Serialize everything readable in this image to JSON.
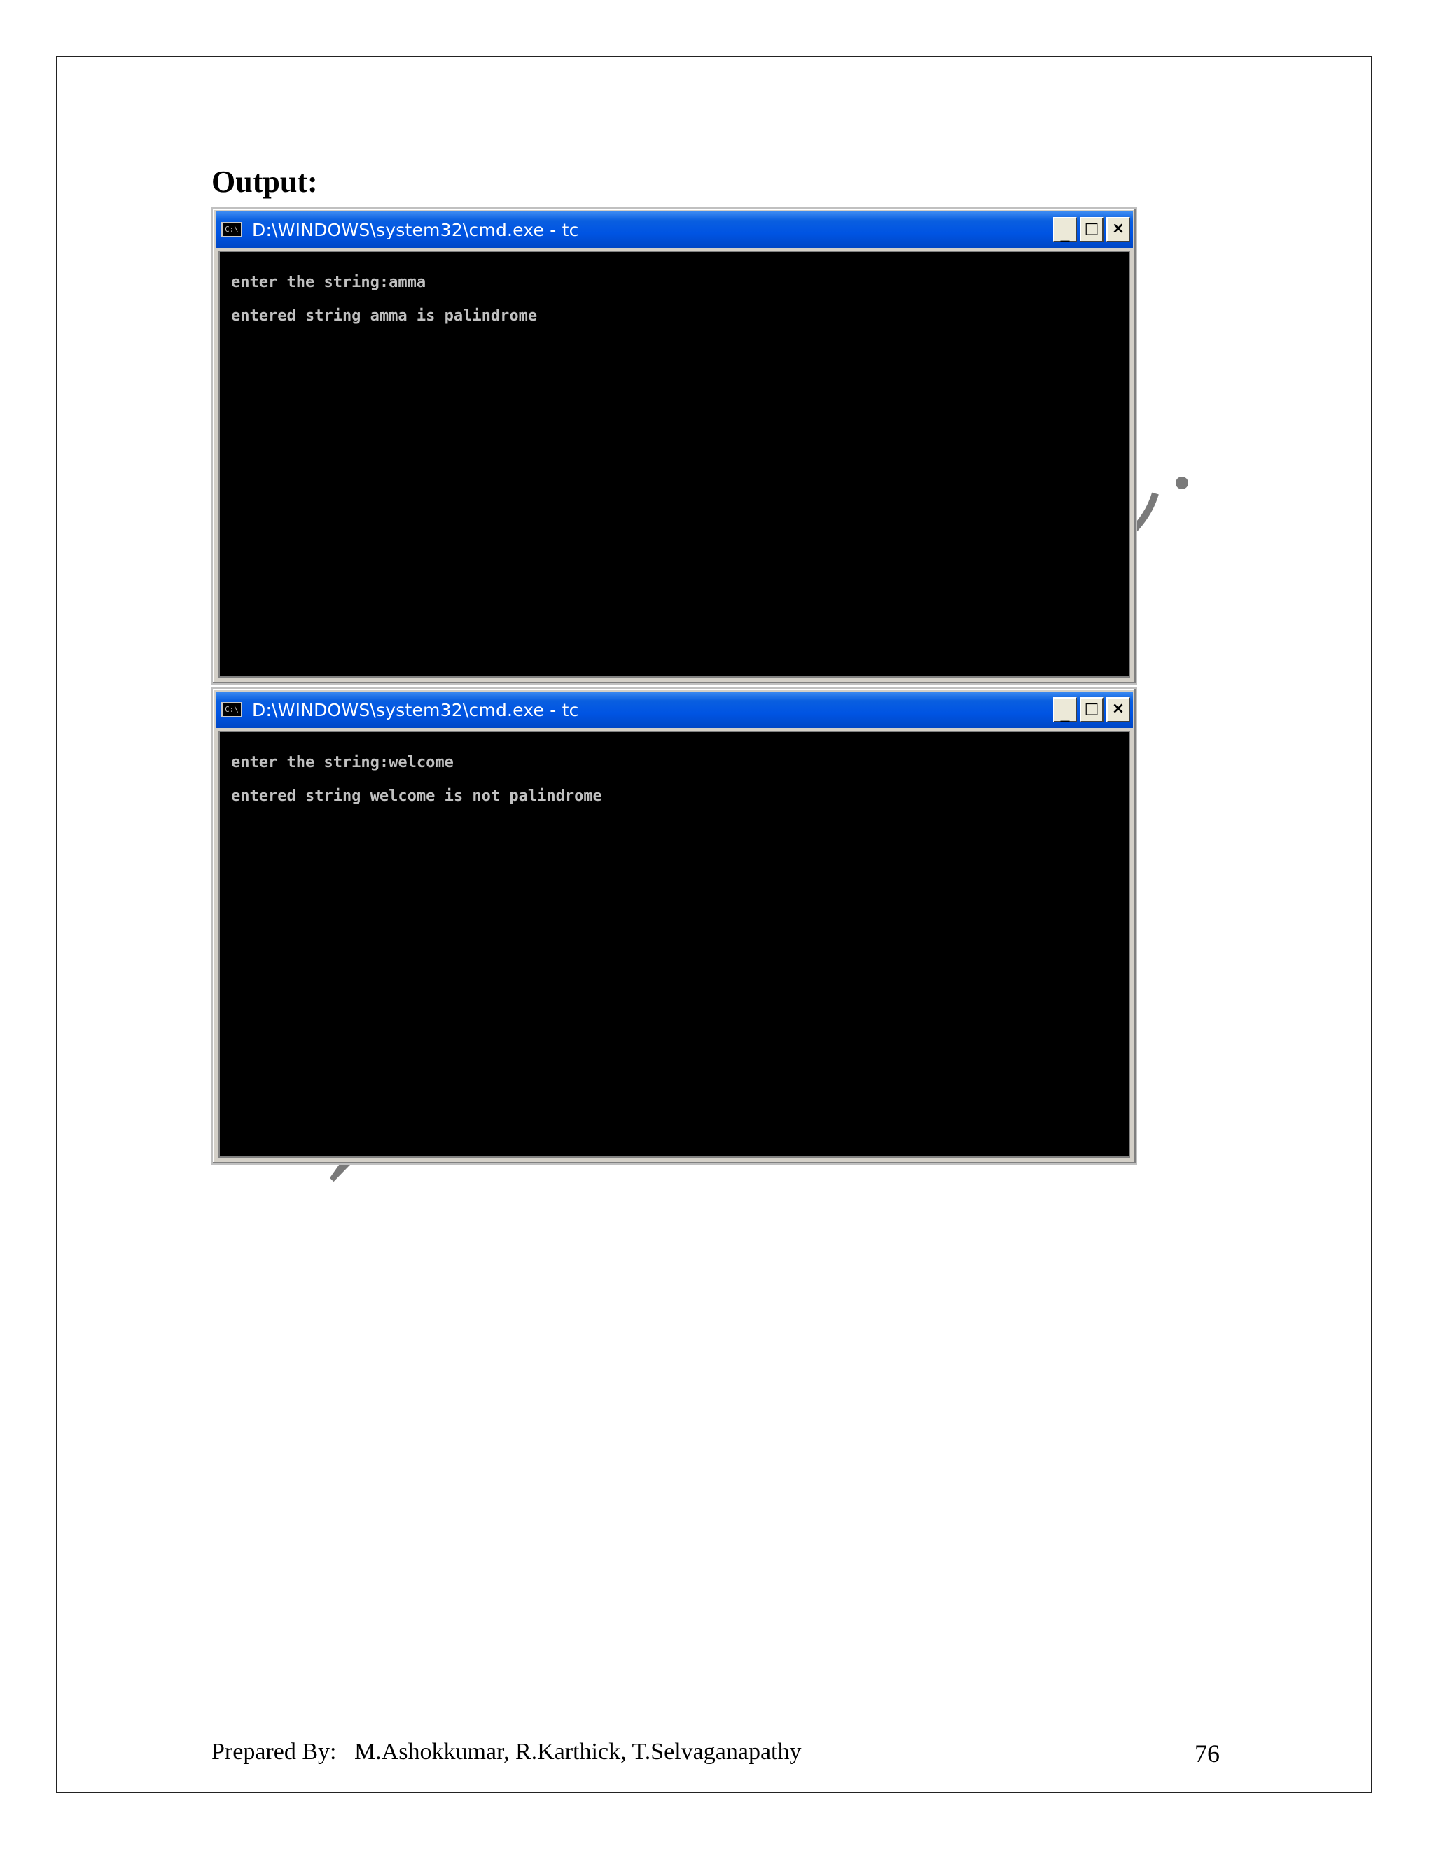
{
  "document": {
    "heading": "Output:",
    "watermark_text": "Depar"
  },
  "windows": [
    {
      "title": "D:\\WINDOWS\\system32\\cmd.exe - tc",
      "icon_label": "C:\\",
      "icon": "console-window-icon",
      "buttons": {
        "minimize": "_",
        "maximize": "□",
        "close": "×"
      },
      "lines": [
        "enter the string:amma",
        "entered string amma is palindrome"
      ]
    },
    {
      "title": "D:\\WINDOWS\\system32\\cmd.exe - tc",
      "icon_label": "C:\\",
      "icon": "console-window-icon",
      "buttons": {
        "minimize": "_",
        "maximize": "□",
        "close": "×"
      },
      "lines": [
        "enter the string:welcome",
        "entered string welcome is not palindrome"
      ]
    }
  ],
  "footer": {
    "credit": "Prepared By:   M.Ashokkumar, R.Karthick, T.Selvaganapathy",
    "page_number": "76"
  },
  "colors": {
    "titlebar": "#0054e3",
    "console_bg": "#000000",
    "console_text": "#c0c0c0",
    "watermark": "#7a7a7a"
  }
}
